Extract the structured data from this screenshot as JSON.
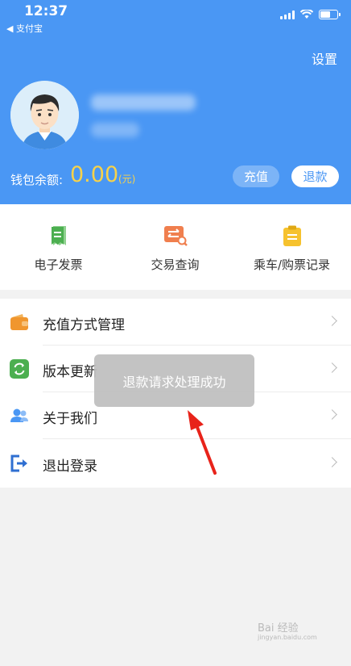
{
  "status_bar": {
    "time": "12:37",
    "back_app": "支付宝",
    "battery_level": 0.6
  },
  "header": {
    "settings_label": "设置",
    "wallet_label": "钱包余额:",
    "wallet_amount": "0.00",
    "wallet_unit": "(元)",
    "recharge_label": "充值",
    "refund_label": "退款",
    "bg_color": "#4a97f4",
    "amount_color": "#f7d24a"
  },
  "quick_actions": [
    {
      "label": "电子发票",
      "icon": "invoice-icon",
      "color": "#4caf50"
    },
    {
      "label": "交易查询",
      "icon": "transaction-search-icon",
      "color": "#f07f4e"
    },
    {
      "label": "乘车/购票记录",
      "icon": "clipboard-icon",
      "color": "#f6c22e"
    }
  ],
  "menu": [
    {
      "label": "充值方式管理",
      "icon": "wallet-icon"
    },
    {
      "label": "版本更新",
      "icon": "refresh-icon"
    },
    {
      "label": "关于我们",
      "icon": "users-icon"
    },
    {
      "label": "退出登录",
      "icon": "logout-icon"
    }
  ],
  "toast": {
    "message": "退款请求处理成功"
  },
  "watermark": {
    "text": "Bai 经验",
    "sub": "jingyan.baidu.com"
  }
}
